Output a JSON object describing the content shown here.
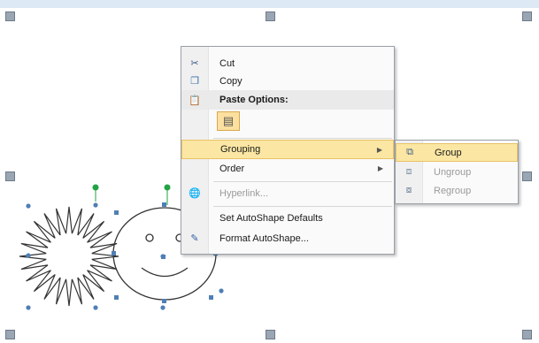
{
  "context_menu": {
    "items": {
      "cut": "Cut",
      "copy": "Copy",
      "paste_options": "Paste Options:",
      "grouping": "Grouping",
      "order": "Order",
      "hyperlink": "Hyperlink...",
      "set_defaults": "Set AutoShape Defaults",
      "format_autoshape": "Format AutoShape..."
    }
  },
  "grouping_submenu": {
    "items": {
      "group": "Group",
      "ungroup": "Ungroup",
      "regroup": "Regroup"
    }
  },
  "icons": {
    "cut": "scissors-icon",
    "copy": "copy-icon",
    "paste": "clipboard-icon",
    "paste_option": "keep-formatting-icon",
    "hyperlink": "hyperlink-globe-icon",
    "format": "format-autoshape-icon",
    "group": "group-icon",
    "ungroup": "ungroup-icon",
    "regroup": "regroup-icon"
  },
  "colors": {
    "highlight": "#fbe7a3",
    "rotation_handle": "#22a344",
    "selection_handle": "#4f7fb5"
  }
}
